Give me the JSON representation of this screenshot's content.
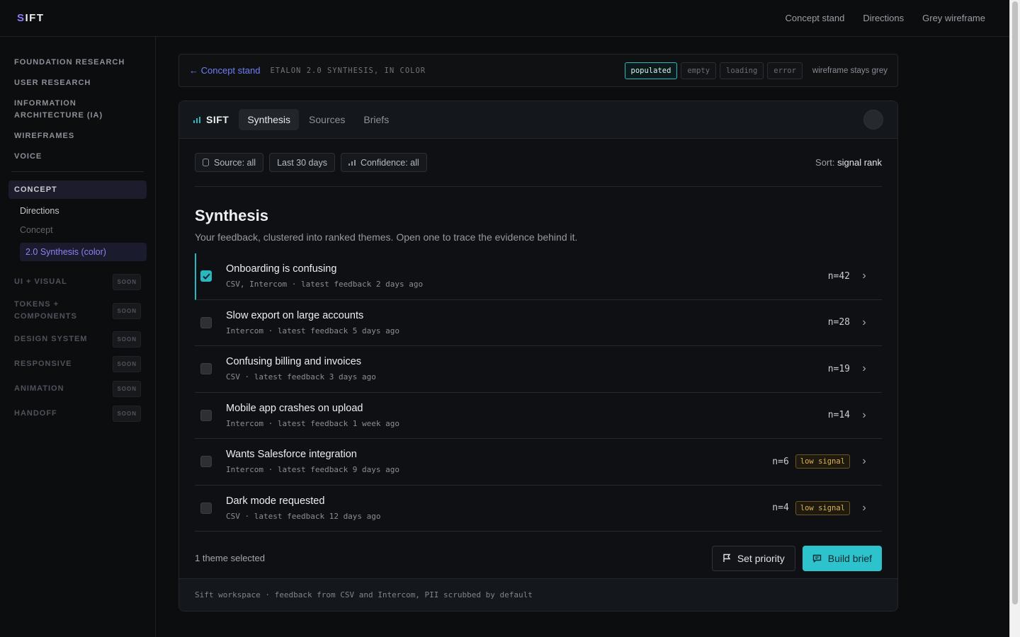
{
  "app": {
    "logo_first": "S",
    "logo_rest": "IFT"
  },
  "topnav": [
    "Concept stand",
    "Directions",
    "Grey wireframe"
  ],
  "sidebar": {
    "items": [
      "FOUNDATION RESEARCH",
      "USER RESEARCH",
      "INFORMATION ARCHITECTURE (IA)",
      "WIREFRAMES",
      "VOICE"
    ],
    "active_section": "CONCEPT",
    "sub_items": [
      "Directions",
      "Concept"
    ],
    "active_sub_item": "2.0 Synthesis (color)",
    "soon_items": [
      "UI + VISUAL",
      "TOKENS + COMPONENTS",
      "DESIGN SYSTEM",
      "RESPONSIVE",
      "ANIMATION",
      "HANDOFF"
    ],
    "soon_label": "SOON"
  },
  "concept_bar": {
    "back_label": "← Concept stand",
    "title": "ETALON 2.0 SYNTHESIS, IN COLOR",
    "states": [
      "populated",
      "empty",
      "loading",
      "error"
    ],
    "active_state": "populated",
    "note": "wireframe stays grey"
  },
  "card": {
    "brand": "SIFT",
    "tabs": [
      "Synthesis",
      "Sources",
      "Briefs"
    ],
    "active_tab": "Synthesis",
    "filters": [
      "Source: all",
      "Last 30 days",
      "Confidence: all"
    ],
    "sort_label": "Sort:",
    "sort_value": "signal rank",
    "title": "Synthesis",
    "subtitle": "Your feedback, clustered into ranked themes. Open one to trace the evidence behind it.",
    "themes": [
      {
        "title": "Onboarding is confusing",
        "meta": "CSV, Intercom · latest feedback 2 days ago",
        "count": "n=42",
        "low_signal": false,
        "checked": true
      },
      {
        "title": "Slow export on large accounts",
        "meta": "Intercom · latest feedback 5 days ago",
        "count": "n=28",
        "low_signal": false,
        "checked": false
      },
      {
        "title": "Confusing billing and invoices",
        "meta": "CSV · latest feedback 3 days ago",
        "count": "n=19",
        "low_signal": false,
        "checked": false
      },
      {
        "title": "Mobile app crashes on upload",
        "meta": "Intercom · latest feedback 1 week ago",
        "count": "n=14",
        "low_signal": false,
        "checked": false
      },
      {
        "title": "Wants Salesforce integration",
        "meta": "Intercom · latest feedback 9 days ago",
        "count": "n=6",
        "low_signal": true,
        "checked": false
      },
      {
        "title": "Dark mode requested",
        "meta": "CSV · latest feedback 12 days ago",
        "count": "n=4",
        "low_signal": true,
        "checked": false
      }
    ],
    "low_signal_label": "low signal",
    "selected_count": "1 theme selected",
    "set_priority_label": "Set priority",
    "build_brief_label": "Build brief",
    "footer": "Sift workspace · feedback from CSV and Intercom, PII scrubbed by default"
  },
  "colors": {
    "accent": "#2bb7bf",
    "brand_purple": "#8b7cf6",
    "warning": "#e0b24a"
  }
}
